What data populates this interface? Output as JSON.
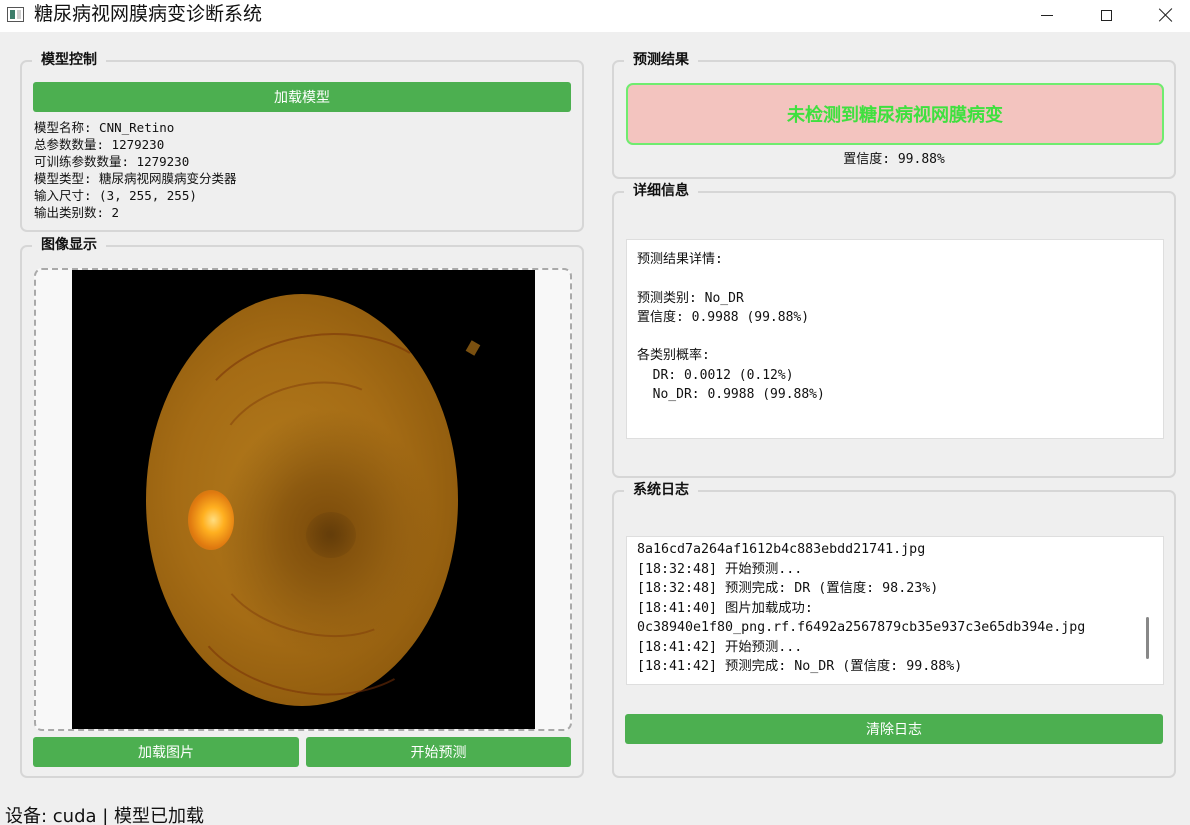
{
  "window": {
    "title": "糖尿病视网膜病变诊断系统",
    "icons": {
      "app": "app-icon",
      "minimize": "minimize-icon",
      "maximize": "maximize-icon",
      "close": "close-icon"
    }
  },
  "model_control": {
    "title": "模型控制",
    "load_button": "加载模型",
    "info": [
      "模型名称: CNN_Retino",
      "总参数数量: 1279230",
      "可训练参数数量: 1279230",
      "模型类型: 糖尿病视网膜病变分类器",
      "输入尺寸: (3, 255, 255)",
      "输出类别数: 2"
    ]
  },
  "image_display": {
    "title": "图像显示",
    "load_image_button": "加载图片",
    "predict_button": "开始预测"
  },
  "prediction": {
    "title": "预测结果",
    "result_text": "未检测到糖尿病视网膜病变",
    "confidence": "置信度: 99.88%"
  },
  "details": {
    "title": "详细信息",
    "lines": [
      "预测结果详情:",
      "",
      "预测类别: No_DR",
      "置信度: 0.9988 (99.88%)",
      "",
      "各类别概率:",
      "  DR: 0.0012 (0.12%)",
      "  No_DR: 0.9988 (99.88%)"
    ]
  },
  "log": {
    "title": "系统日志",
    "lines": [
      "8a16cd7a264af1612b4c883ebdd21741.jpg",
      "[18:32:48] 开始预测...",
      "[18:32:48] 预测完成: DR (置信度: 98.23%)",
      "[18:41:40] 图片加载成功:",
      "0c38940e1f80_png.rf.f6492a2567879cb35e937c3e65db394e.jpg",
      "[18:41:42] 开始预测...",
      "[18:41:42] 预测完成: No_DR (置信度: 99.88%)"
    ],
    "clear_button": "清除日志"
  },
  "status_bar": "设备: cuda | 模型已加载",
  "colors": {
    "button_green": "#4caf50",
    "result_bg": "#f3c4bf",
    "result_border": "#6fec6f",
    "result_text": "#3fe03f"
  }
}
